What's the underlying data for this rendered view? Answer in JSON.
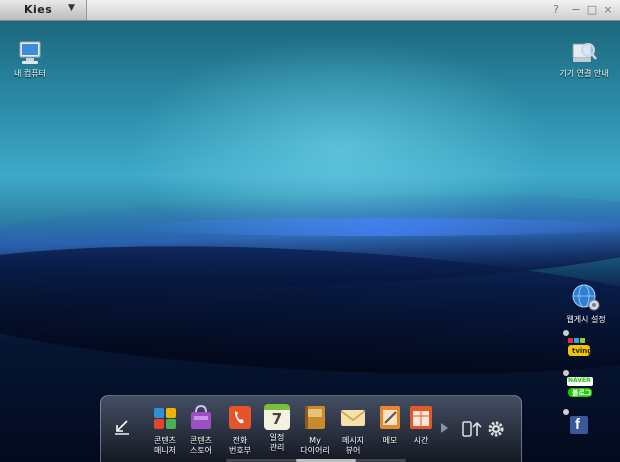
{
  "app": {
    "title": "Kies",
    "menu_caret": "▼"
  },
  "window_controls": {
    "help": "?",
    "minimize": "−",
    "maximize": "□",
    "close": "×"
  },
  "desktop": {
    "my_computer": "내 컴퓨터",
    "connect_guide": "기기 연결 안내",
    "board_settings": "웹게시 설정"
  },
  "dock": {
    "items": [
      {
        "label": "콘텐츠\n매니저"
      },
      {
        "label": "콘텐츠\n스토어"
      },
      {
        "label": "전화\n번호부"
      },
      {
        "label": "일정\n관리"
      },
      {
        "label": "My\n다이어리"
      },
      {
        "label": "메시지\n뷰어"
      },
      {
        "label": "메모"
      },
      {
        "label": "시간"
      }
    ],
    "calendar_day": "7"
  },
  "widgets": {
    "tving": "tving",
    "naver": "NAVER",
    "naver_blog": "블로그",
    "facebook": "f"
  },
  "colors": {
    "titlebar": "#dcdcdc",
    "desktop_top": "#2a8aa6",
    "desktop_bottom": "#030a1d"
  }
}
